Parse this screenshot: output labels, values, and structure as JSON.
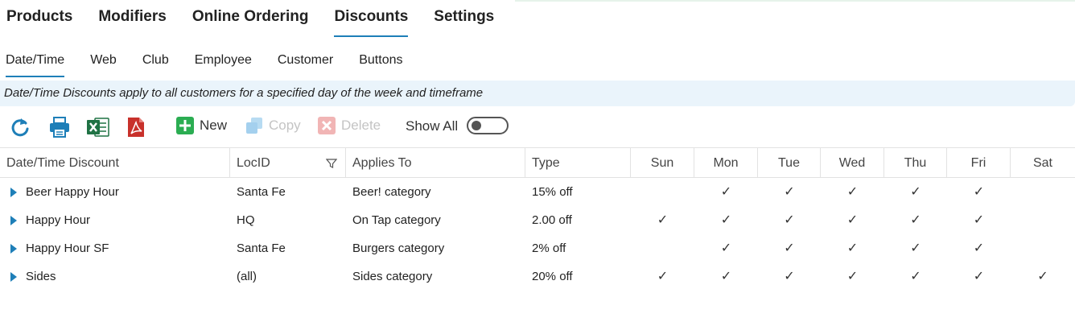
{
  "colors": {
    "accent": "#1e7fb8",
    "banner_bg": "#eaf4fb",
    "excel": "#1f7244",
    "pdf": "#c8312b",
    "new": "#2bad52"
  },
  "top_nav": {
    "tabs": [
      {
        "label": "Products",
        "active": false
      },
      {
        "label": "Modifiers",
        "active": false
      },
      {
        "label": "Online Ordering",
        "active": false
      },
      {
        "label": "Discounts",
        "active": true
      },
      {
        "label": "Settings",
        "active": false
      }
    ]
  },
  "sub_nav": {
    "tabs": [
      {
        "label": "Date/Time",
        "active": true
      },
      {
        "label": "Web",
        "active": false
      },
      {
        "label": "Club",
        "active": false
      },
      {
        "label": "Employee",
        "active": false
      },
      {
        "label": "Customer",
        "active": false
      },
      {
        "label": "Buttons",
        "active": false
      }
    ]
  },
  "banner": {
    "text": "Date/Time Discounts apply to all customers for a specified day of the week and timeframe"
  },
  "toolbar": {
    "icons": [
      "refresh-icon",
      "print-icon",
      "excel-icon",
      "pdf-icon"
    ],
    "new_label": "New",
    "copy_label": "Copy",
    "delete_label": "Delete",
    "show_all_label": "Show All",
    "show_all_on": false
  },
  "table": {
    "headers": [
      "Date/Time Discount",
      "LocID",
      "Applies To",
      "Type",
      "Sun",
      "Mon",
      "Tue",
      "Wed",
      "Thu",
      "Fri",
      "Sat"
    ],
    "check_glyph": "✓",
    "rows": [
      {
        "name": "Beer Happy Hour",
        "loc": "Santa Fe",
        "applies": "Beer! category",
        "type": "15% off",
        "days": [
          false,
          true,
          true,
          true,
          true,
          true,
          false
        ]
      },
      {
        "name": "Happy Hour",
        "loc": "HQ",
        "applies": "On Tap category",
        "type": "2.00 off",
        "days": [
          true,
          true,
          true,
          true,
          true,
          true,
          false
        ]
      },
      {
        "name": "Happy Hour SF",
        "loc": "Santa Fe",
        "applies": "Burgers category",
        "type": "2% off",
        "days": [
          false,
          true,
          true,
          true,
          true,
          true,
          false
        ]
      },
      {
        "name": "Sides",
        "loc": "(all)",
        "applies": "Sides category",
        "type": "20% off",
        "days": [
          true,
          true,
          true,
          true,
          true,
          true,
          true
        ]
      }
    ]
  }
}
